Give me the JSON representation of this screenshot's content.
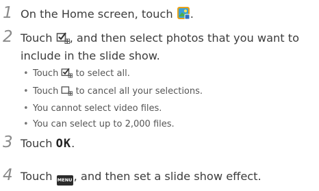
{
  "steps": [
    {
      "num": "1",
      "pre": "On the Home screen, touch ",
      "post": ".",
      "icon": "gallery-app-icon"
    },
    {
      "num": "2",
      "pre": "Touch ",
      "post": ", and then select photos that you want to",
      "line2": "include in the slide show.",
      "icon": "select-checkbox-icon"
    },
    {
      "num": "3",
      "pre": "Touch ",
      "ok": "OK",
      "post": "."
    },
    {
      "num": "4",
      "pre": "Touch ",
      "menu": "MENU",
      "post": ", and then set a slide show effect.",
      "icon": "menu-key-icon"
    }
  ],
  "bullets": {
    "b1_pre": "Touch ",
    "b1_post": " to select all.",
    "b2_pre": "Touch ",
    "b2_post": " to cancel all your selections.",
    "b3": "You cannot select video files.",
    "b4": "You can select up to 2,000 files."
  },
  "colors": {
    "step_number": "#8a8a8a",
    "text": "#3c3c3c",
    "icon_orange": "#e8a21a",
    "icon_blue": "#3a7fd0"
  }
}
